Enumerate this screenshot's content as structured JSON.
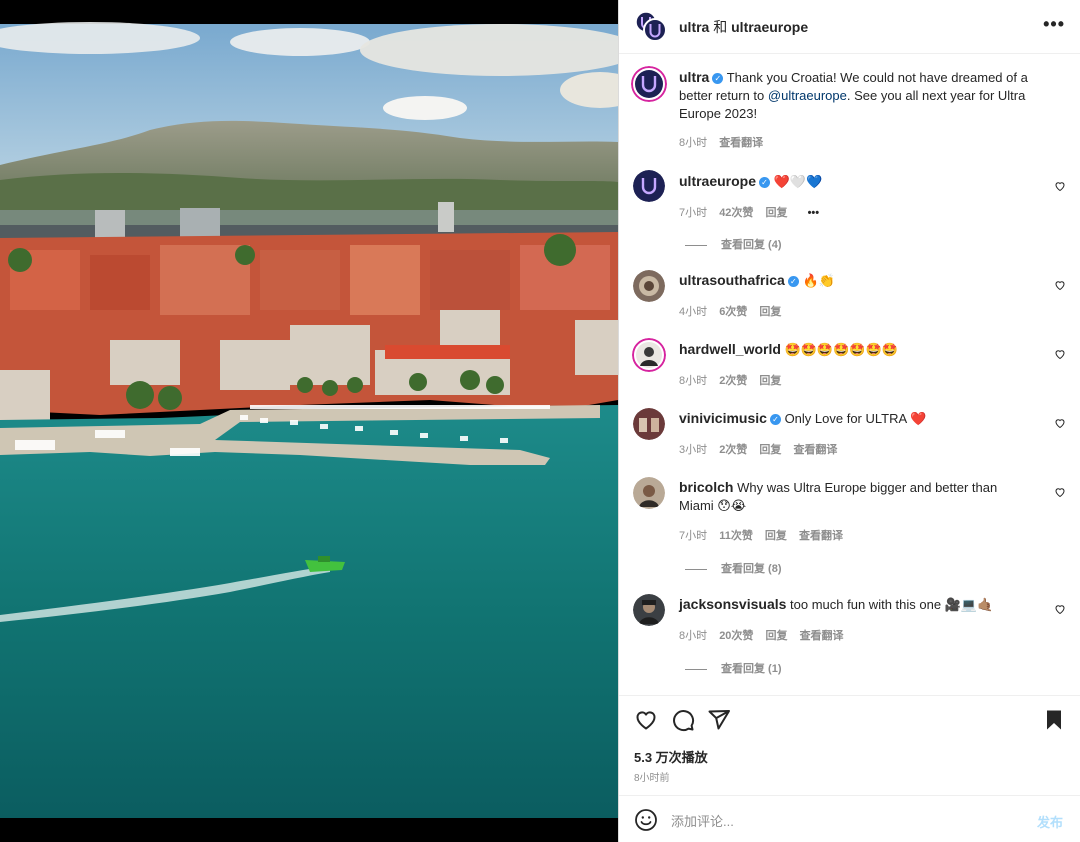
{
  "post": {
    "header_user1": "ultra",
    "header_and": "和",
    "header_user2": "ultraeurope",
    "more_icon": "more-horizontal-icon",
    "caption": {
      "user": "ultra",
      "text_before": "Thank you Croatia! We could not have dreamed of a better return to ",
      "mention": "@ultraeurope",
      "text_after": ". See you all next year for Ultra Europe 2023!",
      "time": "8小时",
      "translate": "查看翻译"
    }
  },
  "comments": [
    {
      "user": "ultraeurope",
      "verified": true,
      "text": "❤️🤍💙",
      "time": "7小时",
      "likes": "42次赞",
      "reply": "回复",
      "extra": "•••",
      "view_replies": "查看回复 (4)"
    },
    {
      "user": "ultrasouthafrica",
      "verified": true,
      "text": "🔥👏",
      "time": "4小时",
      "likes": "6次赞",
      "reply": "回复"
    },
    {
      "user": "hardwell_world",
      "verified": false,
      "text": "🤩🤩🤩🤩🤩🤩🤩",
      "time": "8小时",
      "likes": "2次赞",
      "reply": "回复"
    },
    {
      "user": "vinivicimusic",
      "verified": true,
      "text": "Only Love for ULTRA ❤️",
      "time": "3小时",
      "likes": "2次赞",
      "reply": "回复",
      "translate": "查看翻译"
    },
    {
      "user": "bricolch",
      "verified": false,
      "text": "Why was Ultra Europe bigger and better than Miami 😯😭",
      "time": "7小时",
      "likes": "11次赞",
      "reply": "回复",
      "translate": "查看翻译",
      "view_replies": "查看回复 (8)"
    },
    {
      "user": "jacksonsvisuals",
      "verified": false,
      "text": "too much fun with this one 🎥💻🤙🏽",
      "time": "8小时",
      "likes": "20次赞",
      "reply": "回复",
      "translate": "查看翻译",
      "view_replies": "查看回复 (1)"
    }
  ],
  "actions": {
    "like_icon": "heart-icon",
    "comment_icon": "comment-icon",
    "share_icon": "send-icon",
    "save_icon": "bookmark-icon",
    "views": "5.3 万次播放",
    "posted_ago": "8小时前"
  },
  "add_comment": {
    "emoji_icon": "emoji-icon",
    "placeholder": "添加评论...",
    "post_label": "发布"
  },
  "colors": {
    "verified": "#3897f0",
    "mention": "#00376b",
    "post_disabled": "#b2dffc",
    "meta": "#8e8e8e"
  }
}
